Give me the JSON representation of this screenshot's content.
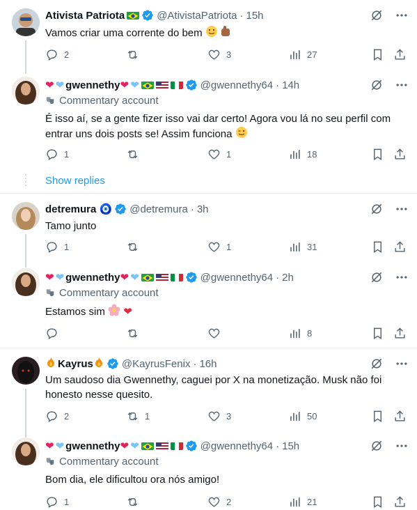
{
  "posts": [
    {
      "name": "Ativista Patriota",
      "handle": "@AtivistaPatriota",
      "time": "15h",
      "commentary": "",
      "text": "Vamos criar uma corrente do bem",
      "replies": "2",
      "reposts": "",
      "likes": "3",
      "views": "27"
    },
    {
      "name": "gwennethy",
      "handle": "@gwennethy64",
      "time": "14h",
      "commentary": "Commentary account",
      "text": "É isso aí, se a gente fizer isso vai dar certo!  Agora vou lá no seu perfil com entrar uns dois posts se! Assim funciona",
      "replies": "1",
      "reposts": "",
      "likes": "1",
      "views": "18"
    },
    {
      "name": "detremura 🧿",
      "handle": "@detremura",
      "time": "3h",
      "commentary": "",
      "text": "Tamo junto",
      "replies": "1",
      "reposts": "",
      "likes": "1",
      "views": "31"
    },
    {
      "name": "gwennethy",
      "handle": "@gwennethy64",
      "time": "2h",
      "commentary": "Commentary account",
      "text": "Estamos sim",
      "replies": "",
      "reposts": "",
      "likes": "",
      "views": "8"
    },
    {
      "name": "Kayrus",
      "handle": "@KayrusFenix",
      "time": "16h",
      "commentary": "",
      "text": "Um saudoso dia Gwennethy, caguei por X na monetização. Musk não foi honesto nesse quesito.",
      "replies": "2",
      "reposts": "1",
      "likes": "3",
      "views": "50"
    },
    {
      "name": "gwennethy",
      "handle": "@gwennethy64",
      "time": "15h",
      "commentary": "Commentary account",
      "text": "Bom dia, ele dificultou ora nós amigo!",
      "replies": "1",
      "reposts": "",
      "likes": "2",
      "views": "21"
    }
  ],
  "show_replies": "Show replies",
  "dot": "·",
  "colors": {
    "accent": "#1d9bf0",
    "secondary": "#536471",
    "border": "#eff3f4"
  }
}
